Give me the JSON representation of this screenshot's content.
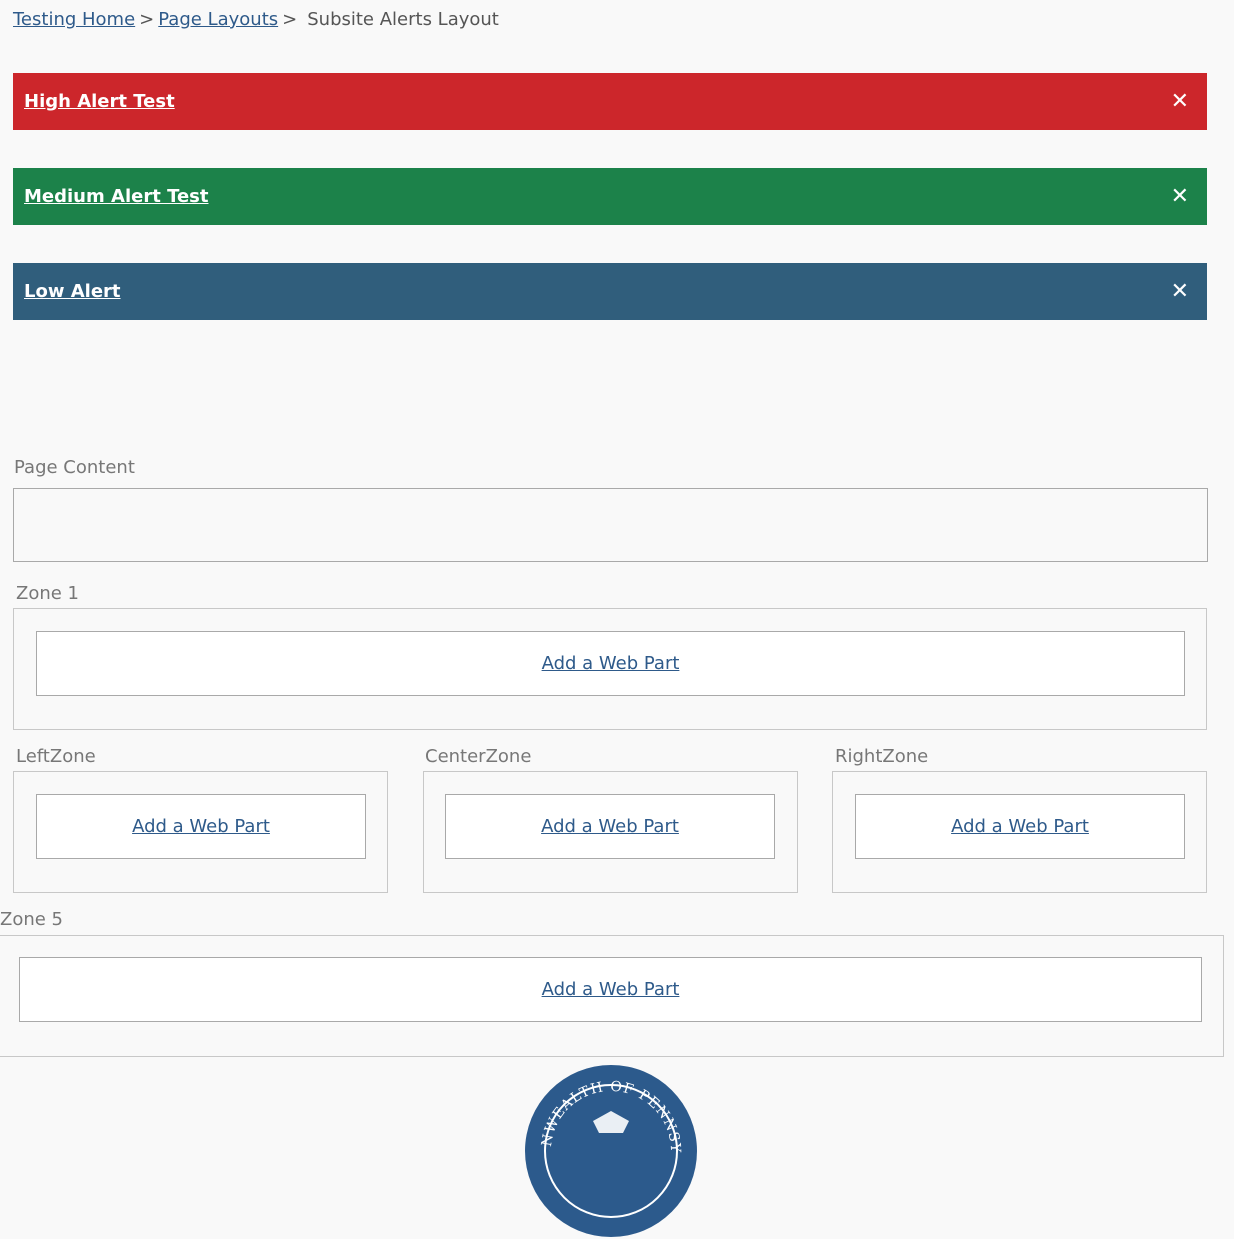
{
  "breadcrumb": {
    "items": [
      "Testing Home",
      "Page Layouts"
    ],
    "separator": ">",
    "current": "Subsite Alerts Layout"
  },
  "alerts": [
    {
      "label": "High Alert Test",
      "close": "✕",
      "color": "#cc262b"
    },
    {
      "label": "Medium Alert Test",
      "close": "✕",
      "color": "#1c824a"
    },
    {
      "label": "Low Alert",
      "close": "✕",
      "color": "#305e7c"
    }
  ],
  "page_content": {
    "label": "Page Content"
  },
  "zones": {
    "zone1": {
      "label": "Zone 1",
      "action": "Add a Web Part"
    },
    "left": {
      "label": "LeftZone",
      "action": "Add a Web Part"
    },
    "center": {
      "label": "CenterZone",
      "action": "Add a Web Part"
    },
    "right": {
      "label": "RightZone",
      "action": "Add a Web Part"
    },
    "zone5": {
      "label": "Zone 5",
      "action": "Add a Web Part"
    }
  },
  "footer": {
    "seal_text": "COMMONWEALTH OF PENNSYLVANIA",
    "seal_color": "#2c5a8c"
  }
}
